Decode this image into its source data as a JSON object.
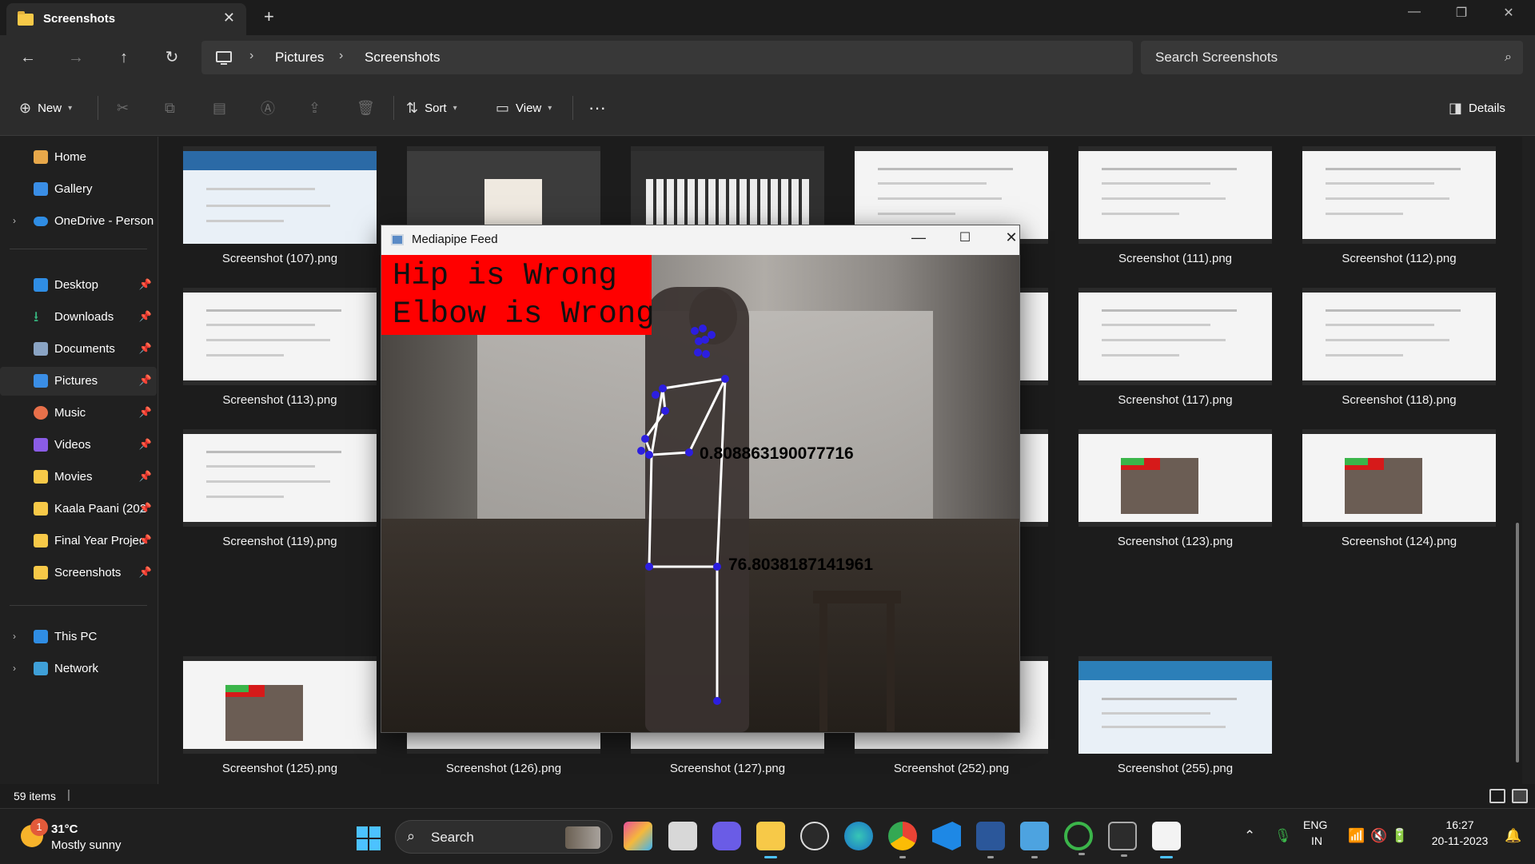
{
  "tab": {
    "title": "Screenshots"
  },
  "breadcrumb": [
    "Pictures",
    "Screenshots"
  ],
  "search": {
    "placeholder": "Search Screenshots"
  },
  "toolbar": {
    "new": "New",
    "sort": "Sort",
    "view": "View",
    "details": "Details"
  },
  "sidebar": {
    "home": "Home",
    "gallery": "Gallery",
    "onedrive": "OneDrive - Persona",
    "desktop": "Desktop",
    "downloads": "Downloads",
    "documents": "Documents",
    "pictures": "Pictures",
    "music": "Music",
    "videos": "Videos",
    "movies": "Movies",
    "kaala": "Kaala Paani (202",
    "finalyear": "Final Year Projec",
    "screenshots": "Screenshots",
    "thispc": "This PC",
    "network": "Network"
  },
  "files": {
    "f107": "Screenshot (107).png",
    "f111": "Screenshot (111).png",
    "f112": "Screenshot (112).png",
    "f113": "Screenshot (113).png",
    "f117": "Screenshot (117).png",
    "f118": "Screenshot (118).png",
    "f119": "Screenshot (119).png",
    "f123": "Screenshot (123).png",
    "f124": "Screenshot (124).png",
    "f125": "Screenshot (125).png",
    "f126": "Screenshot (126).png",
    "f127": "Screenshot (127).png",
    "f252": "Screenshot (252).png",
    "f255": "Screenshot (255).png"
  },
  "mediapipe": {
    "title": "Mediapipe Feed",
    "alert_line1": "Hip is Wrong",
    "alert_line2": "Elbow is Wrong",
    "angle1": "0.808863190077716",
    "angle2": "76.8038187141961"
  },
  "status": {
    "items": "59 items"
  },
  "weather": {
    "temp": "31°C",
    "condition": "Mostly sunny",
    "badge": "1"
  },
  "taskbar": {
    "search": "Search"
  },
  "tray": {
    "lang1": "ENG",
    "lang2": "IN",
    "time": "16:27",
    "date": "20-11-2023"
  },
  "colors": {
    "accent": "#4cc2ff",
    "alert_red": "#ff0000",
    "folder": "#f7c948"
  }
}
